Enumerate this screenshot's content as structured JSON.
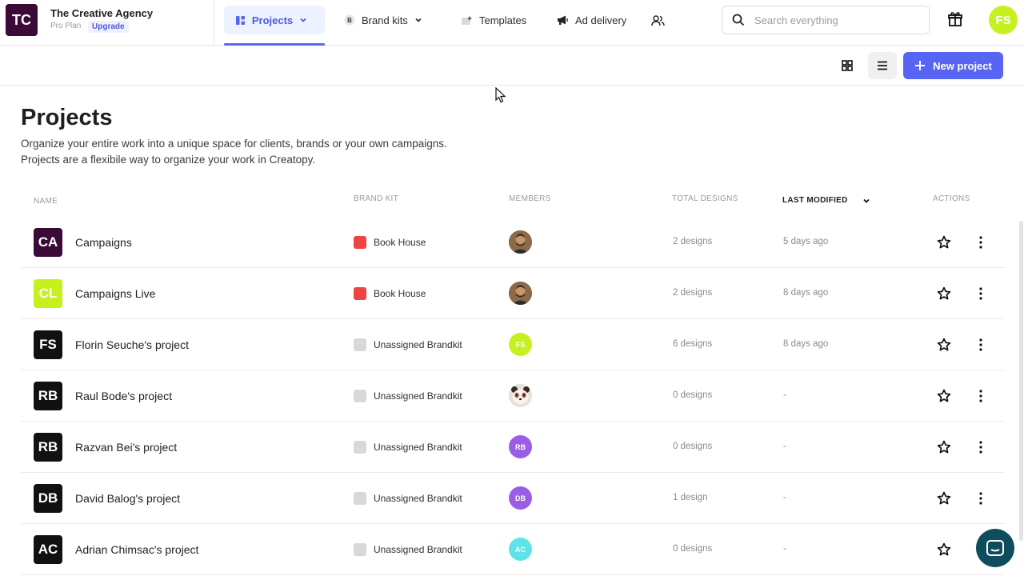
{
  "org": {
    "initials": "TC",
    "name": "The Creative Agency",
    "plan": "Pro Plan",
    "upgrade": "Upgrade",
    "avatar_color": "#3b0a37"
  },
  "nav": {
    "projects": "Projects",
    "brand_kits": "Brand kits",
    "templates": "Templates",
    "ad_delivery": "Ad delivery",
    "team_icon": "people-icon"
  },
  "search": {
    "placeholder": "Search everything"
  },
  "user": {
    "initials": "FS",
    "color": "#c7f01f"
  },
  "toolbar": {
    "new_project": "New project",
    "accent": "#5865f2"
  },
  "page": {
    "title": "Projects",
    "desc_line1": "Organize your entire work into a unique space for clients, brands or your own campaigns.",
    "desc_line2": "Projects are a flexibile way to organize your work in Creatopy."
  },
  "table": {
    "headers": {
      "name": "NAME",
      "brand_kit": "BRAND KIT",
      "members": "MEMBERS",
      "total_designs": "TOTAL DESIGNS",
      "last_modified": "LAST MODIFIED",
      "actions": "ACTIONS"
    },
    "rows": [
      {
        "initials": "CA",
        "name": "Campaigns",
        "avatar_color": "#3b0a37",
        "brand_kit": "Book House",
        "bk_color": "#ef4444",
        "member": "photo",
        "member_initials": "",
        "member_color": "#7a5a3c",
        "designs": "2 designs",
        "modified": "5 days ago"
      },
      {
        "initials": "CL",
        "name": "Campaigns Live",
        "avatar_color": "#c7f01f",
        "brand_kit": "Book House",
        "bk_color": "#ef4444",
        "member": "photo",
        "member_initials": "",
        "member_color": "#7a5a3c",
        "designs": "2 designs",
        "modified": "8 days ago"
      },
      {
        "initials": "FS",
        "name": "Florin Seuche's project",
        "avatar_color": "#111111",
        "brand_kit": "Unassigned Brandkit",
        "bk_color": "#d8d8d8",
        "member": "initials",
        "member_initials": "FS",
        "member_color": "#c7f01f",
        "designs": "6 designs",
        "modified": "8 days ago"
      },
      {
        "initials": "RB",
        "name": "Raul Bode's project",
        "avatar_color": "#111111",
        "brand_kit": "Unassigned Brandkit",
        "bk_color": "#d8d8d8",
        "member": "panda",
        "member_initials": "",
        "member_color": "#e6e0da",
        "designs": "0 designs",
        "modified": "-"
      },
      {
        "initials": "RB",
        "name": "Razvan Bei's project",
        "avatar_color": "#111111",
        "brand_kit": "Unassigned Brandkit",
        "bk_color": "#d8d8d8",
        "member": "initials",
        "member_initials": "RB",
        "member_color": "#9b5de5",
        "designs": "0 designs",
        "modified": "-"
      },
      {
        "initials": "DB",
        "name": "David Balog's project",
        "avatar_color": "#111111",
        "brand_kit": "Unassigned Brandkit",
        "bk_color": "#d8d8d8",
        "member": "initials",
        "member_initials": "DB",
        "member_color": "#9b5de5",
        "designs": "1 design",
        "modified": "-"
      },
      {
        "initials": "AC",
        "name": "Adrian Chimsac's project",
        "avatar_color": "#111111",
        "brand_kit": "Unassigned Brandkit",
        "bk_color": "#d8d8d8",
        "member": "initials",
        "member_initials": "AC",
        "member_color": "#5ee3e8",
        "designs": "0 designs",
        "modified": "-"
      }
    ]
  }
}
